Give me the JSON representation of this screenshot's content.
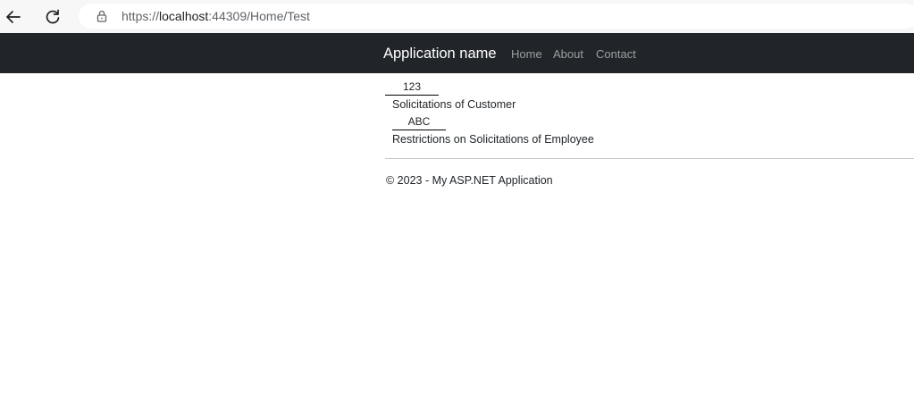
{
  "browser": {
    "url_prefix": "https://",
    "url_host": "localhost",
    "url_rest": ":44309/Home/Test"
  },
  "icons": {
    "back": "arrow-left-icon",
    "refresh": "refresh-icon",
    "lock": "lock-icon"
  },
  "navbar": {
    "brand": "Application name",
    "links": [
      "Home",
      "About",
      "Contact"
    ]
  },
  "content": {
    "fields": [
      {
        "value": "123",
        "label": "Solicitations of Customer"
      },
      {
        "value": "ABC",
        "label": "Restrictions on Solicitations of Employee"
      }
    ]
  },
  "footer": {
    "text": "© 2023 - My ASP.NET Application"
  },
  "colors": {
    "navbar_bg": "#212529",
    "nav_link": "rgba(255,255,255,0.55)",
    "brand": "#ffffff"
  }
}
